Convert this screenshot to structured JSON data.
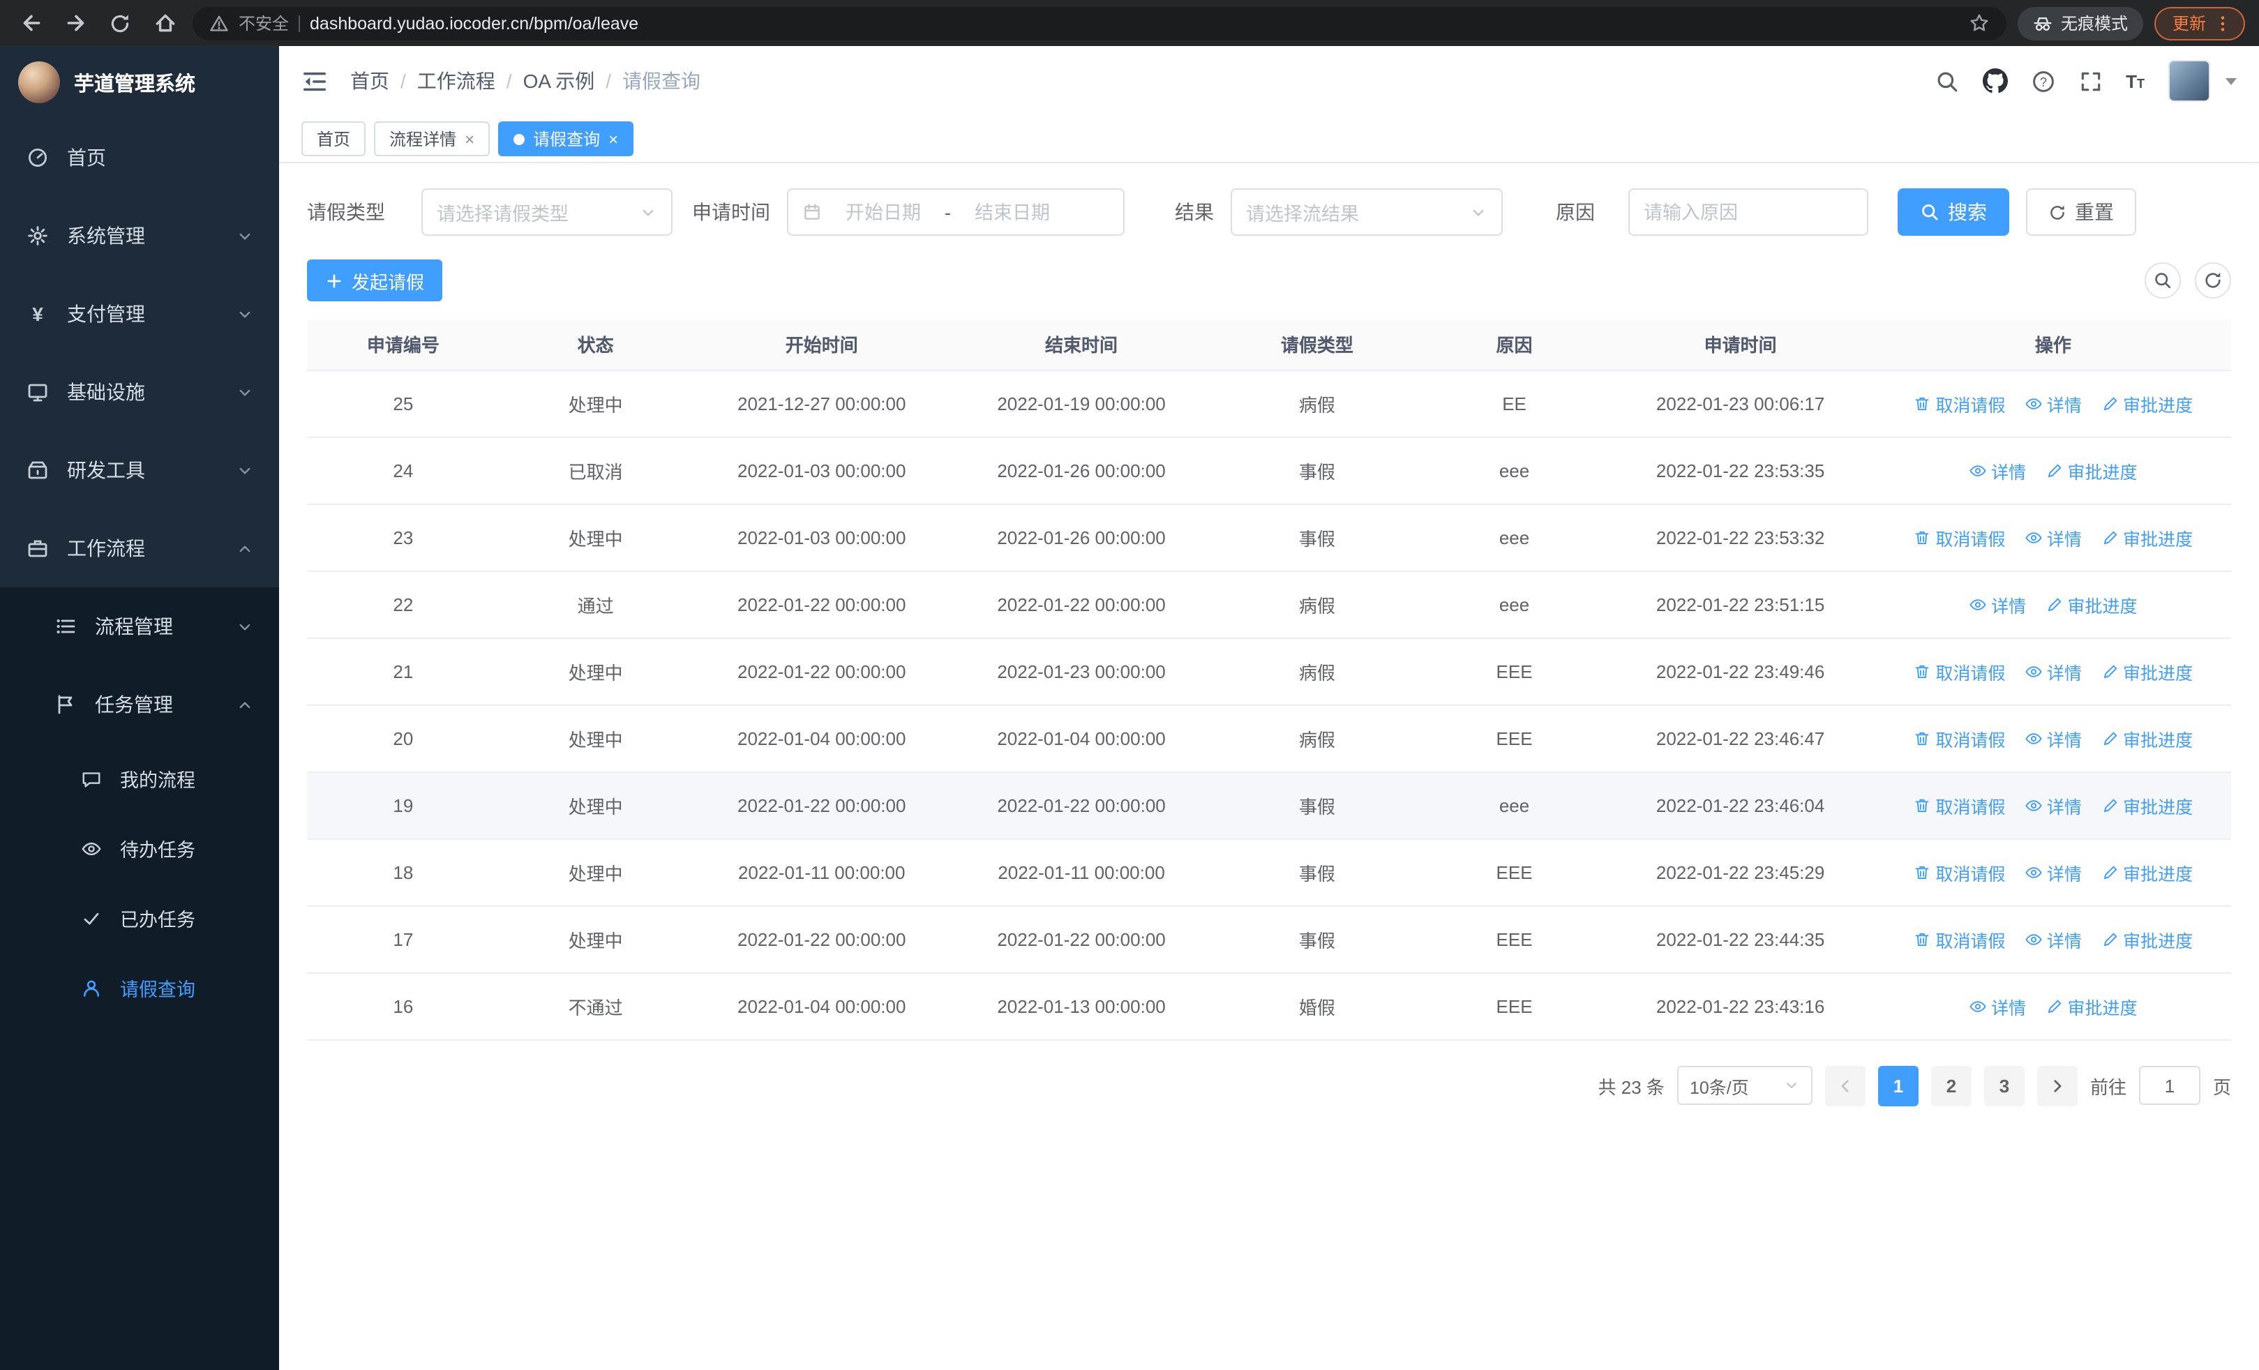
{
  "colors": {
    "accent": "#409eff",
    "sidebar_bg": "#101c28",
    "sidebar_top_bg": "#1d2b3a",
    "chrome_bg": "#242628",
    "update_orange": "#f57f43"
  },
  "browser": {
    "security_warning": "不安全",
    "url": "dashboard.yudao.iocoder.cn/bpm/oa/leave",
    "incognito_label": "无痕模式",
    "update_label": "更新"
  },
  "sidebar": {
    "title": "芋道管理系统",
    "items": [
      {
        "label": "首页",
        "icon": "gauge-icon"
      },
      {
        "label": "系统管理",
        "icon": "gear-icon"
      },
      {
        "label": "支付管理",
        "icon": "yen-icon"
      },
      {
        "label": "基础设施",
        "icon": "monitor-icon"
      },
      {
        "label": "研发工具",
        "icon": "toolbox-icon"
      },
      {
        "label": "工作流程",
        "icon": "briefcase-icon"
      }
    ],
    "workflow_children": [
      {
        "label": "流程管理",
        "icon": "list-icon"
      },
      {
        "label": "任务管理",
        "icon": "flag-icon"
      }
    ],
    "task_children": [
      {
        "label": "我的流程",
        "icon": "chat-icon"
      },
      {
        "label": "待办任务",
        "icon": "eye-icon"
      },
      {
        "label": "已办任务",
        "icon": "check-icon"
      },
      {
        "label": "请假查询",
        "icon": "person-icon"
      }
    ]
  },
  "header": {
    "separator": "/",
    "breadcrumb": [
      "首页",
      "工作流程",
      "OA 示例",
      "请假查询"
    ]
  },
  "tabs": [
    {
      "label": "首页"
    },
    {
      "label": "流程详情"
    },
    {
      "label": "请假查询"
    }
  ],
  "filters": {
    "leave_type_label": "请假类型",
    "leave_type_placeholder": "请选择请假类型",
    "apply_time_label": "申请时间",
    "start_date_placeholder": "开始日期",
    "date_separator": "-",
    "end_date_placeholder": "结束日期",
    "result_label": "结果",
    "result_placeholder": "请选择流结果",
    "reason_label": "原因",
    "reason_placeholder": "请输入原因",
    "search_label": "搜索",
    "reset_label": "重置"
  },
  "toolbar": {
    "create_label": "发起请假"
  },
  "table": {
    "columns": [
      "申请编号",
      "状态",
      "开始时间",
      "结束时间",
      "请假类型",
      "原因",
      "申请时间",
      "操作"
    ],
    "action_labels": {
      "cancel": "取消请假",
      "detail": "详情",
      "progress": "审批进度"
    },
    "rows": [
      {
        "id": "25",
        "status": "处理中",
        "start": "2021-12-27 00:00:00",
        "end": "2022-01-19 00:00:00",
        "type": "病假",
        "reason": "EE",
        "time": "2022-01-23 00:06:17",
        "actions": [
          "cancel",
          "detail",
          "progress"
        ],
        "highlight": false
      },
      {
        "id": "24",
        "status": "已取消",
        "start": "2022-01-03 00:00:00",
        "end": "2022-01-26 00:00:00",
        "type": "事假",
        "reason": "eee",
        "time": "2022-01-22 23:53:35",
        "actions": [
          "detail",
          "progress"
        ],
        "highlight": false
      },
      {
        "id": "23",
        "status": "处理中",
        "start": "2022-01-03 00:00:00",
        "end": "2022-01-26 00:00:00",
        "type": "事假",
        "reason": "eee",
        "time": "2022-01-22 23:53:32",
        "actions": [
          "cancel",
          "detail",
          "progress"
        ],
        "highlight": false
      },
      {
        "id": "22",
        "status": "通过",
        "start": "2022-01-22 00:00:00",
        "end": "2022-01-22 00:00:00",
        "type": "病假",
        "reason": "eee",
        "time": "2022-01-22 23:51:15",
        "actions": [
          "detail",
          "progress"
        ],
        "highlight": false
      },
      {
        "id": "21",
        "status": "处理中",
        "start": "2022-01-22 00:00:00",
        "end": "2022-01-23 00:00:00",
        "type": "病假",
        "reason": "EEE",
        "time": "2022-01-22 23:49:46",
        "actions": [
          "cancel",
          "detail",
          "progress"
        ],
        "highlight": false
      },
      {
        "id": "20",
        "status": "处理中",
        "start": "2022-01-04 00:00:00",
        "end": "2022-01-04 00:00:00",
        "type": "病假",
        "reason": "EEE",
        "time": "2022-01-22 23:46:47",
        "actions": [
          "cancel",
          "detail",
          "progress"
        ],
        "highlight": false
      },
      {
        "id": "19",
        "status": "处理中",
        "start": "2022-01-22 00:00:00",
        "end": "2022-01-22 00:00:00",
        "type": "事假",
        "reason": "eee",
        "time": "2022-01-22 23:46:04",
        "actions": [
          "cancel",
          "detail",
          "progress"
        ],
        "highlight": true
      },
      {
        "id": "18",
        "status": "处理中",
        "start": "2022-01-11 00:00:00",
        "end": "2022-01-11 00:00:00",
        "type": "事假",
        "reason": "EEE",
        "time": "2022-01-22 23:45:29",
        "actions": [
          "cancel",
          "detail",
          "progress"
        ],
        "highlight": false
      },
      {
        "id": "17",
        "status": "处理中",
        "start": "2022-01-22 00:00:00",
        "end": "2022-01-22 00:00:00",
        "type": "事假",
        "reason": "EEE",
        "time": "2022-01-22 23:44:35",
        "actions": [
          "cancel",
          "detail",
          "progress"
        ],
        "highlight": false
      },
      {
        "id": "16",
        "status": "不通过",
        "start": "2022-01-04 00:00:00",
        "end": "2022-01-13 00:00:00",
        "type": "婚假",
        "reason": "EEE",
        "time": "2022-01-22 23:43:16",
        "actions": [
          "detail",
          "progress"
        ],
        "highlight": false
      }
    ]
  },
  "pagination": {
    "total": "共 23 条",
    "page_size": "10条/页",
    "pages": [
      "1",
      "2",
      "3"
    ],
    "active_page": "1",
    "goto_label": "前往",
    "goto_value": "1",
    "unit_label": "页"
  }
}
